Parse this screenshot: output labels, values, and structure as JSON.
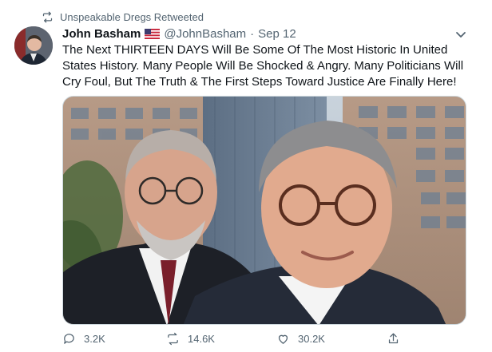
{
  "retweet": {
    "label": "Unspeakable Dregs Retweeted",
    "icon": "retweet-icon"
  },
  "author": {
    "display_name": "John Basham",
    "flag_icon": "us-flag-icon",
    "handle": "@JohnBasham",
    "separator": "·",
    "date": "Sep 12"
  },
  "tweet": {
    "text": "The Next THIRTEEN DAYS Will Be Some Of The Most Historic In United States History. Many People Will Be Shocked & Angry. Many Politicians Will Cry Foul, But The Truth & The First Steps Toward Justice Are Finally Here!"
  },
  "actions": {
    "reply_count": "3.2K",
    "retweet_count": "14.6K",
    "like_count": "30.2K"
  },
  "colors": {
    "muted": "#536471",
    "text": "#0f1419",
    "accent": "#1d9bf0"
  }
}
